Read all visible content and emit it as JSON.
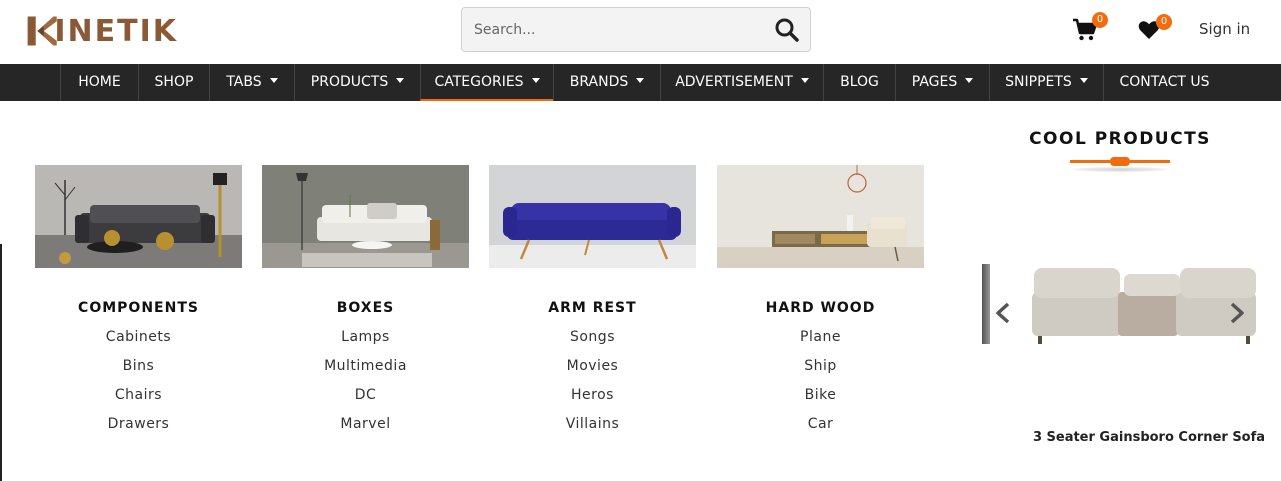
{
  "header": {
    "logo_text": "INETIK",
    "search": {
      "placeholder": "Search..."
    },
    "cart_count": "0",
    "wishlist_count": "0",
    "signin_label": "Sign in"
  },
  "nav": {
    "items": [
      {
        "label": "HOME",
        "dropdown": false
      },
      {
        "label": "SHOP",
        "dropdown": false
      },
      {
        "label": "TABS",
        "dropdown": true
      },
      {
        "label": "PRODUCTS",
        "dropdown": true
      },
      {
        "label": "CATEGORIES",
        "dropdown": true,
        "active": true
      },
      {
        "label": "BRANDS",
        "dropdown": true
      },
      {
        "label": "ADVERTISEMENT",
        "dropdown": true
      },
      {
        "label": "BLOG",
        "dropdown": false
      },
      {
        "label": "PAGES",
        "dropdown": true
      },
      {
        "label": "SNIPPETS",
        "dropdown": true
      },
      {
        "label": "CONTACT US",
        "dropdown": false
      }
    ]
  },
  "mega_menu": {
    "columns": [
      {
        "title": "COMPONENTS",
        "links": [
          "Cabinets",
          "Bins",
          "Chairs",
          "Drawers"
        ]
      },
      {
        "title": "BOXES",
        "links": [
          "Lamps",
          "Multimedia",
          "DC",
          "Marvel"
        ]
      },
      {
        "title": "ARM REST",
        "links": [
          "Songs",
          "Movies",
          "Heros",
          "Villains"
        ]
      },
      {
        "title": "HARD WOOD",
        "links": [
          "Plane",
          "Ship",
          "Bike",
          "Car"
        ]
      }
    ]
  },
  "cool_products": {
    "title": "COOL PRODUCTS",
    "product_name": "3 Seater Gainsboro Corner Sofa"
  },
  "colors": {
    "accent": "#f26c0d",
    "nav_bg": "#262626",
    "logo_brown": "#8a5a36"
  }
}
